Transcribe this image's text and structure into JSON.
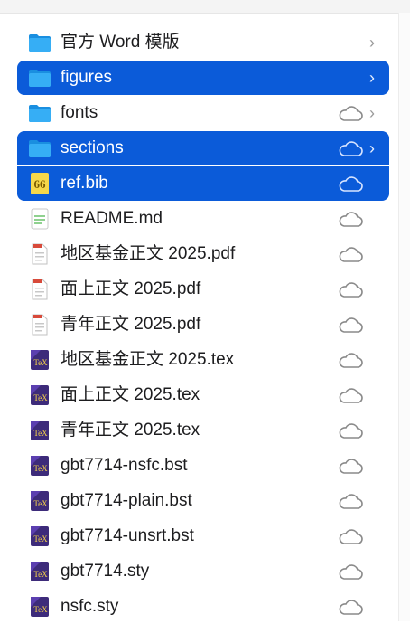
{
  "colors": {
    "selection": "#0b5bd9",
    "folder": "#1ea1f2",
    "text": "#1d1d1f",
    "secondary": "#9a9a9a"
  },
  "files": [
    {
      "label": "官方 Word 模版",
      "icon": "folder-icon",
      "cloud": false,
      "chevron": "›"
    },
    {
      "label": "figures",
      "icon": "folder-icon",
      "cloud": false,
      "chevron": "›"
    },
    {
      "label": "fonts",
      "icon": "folder-icon",
      "cloud": true,
      "chevron": "›"
    },
    {
      "label": "sections",
      "icon": "folder-icon",
      "cloud": true,
      "chevron": "›"
    },
    {
      "label": "ref.bib",
      "icon": "bib-file-icon",
      "cloud": true,
      "chevron": ""
    },
    {
      "label": "README.md",
      "icon": "markdown-file-icon",
      "cloud": true,
      "chevron": ""
    },
    {
      "label": "地区基金正文 2025.pdf",
      "icon": "pdf-file-icon",
      "cloud": true,
      "chevron": ""
    },
    {
      "label": "面上正文 2025.pdf",
      "icon": "pdf-file-icon",
      "cloud": true,
      "chevron": ""
    },
    {
      "label": "青年正文 2025.pdf",
      "icon": "pdf-file-icon",
      "cloud": true,
      "chevron": ""
    },
    {
      "label": "地区基金正文 2025.tex",
      "icon": "tex-file-icon",
      "cloud": true,
      "chevron": ""
    },
    {
      "label": "面上正文 2025.tex",
      "icon": "tex-file-icon",
      "cloud": true,
      "chevron": ""
    },
    {
      "label": "青年正文 2025.tex",
      "icon": "tex-file-icon",
      "cloud": true,
      "chevron": ""
    },
    {
      "label": "gbt7714-nsfc.bst",
      "icon": "tex-file-icon",
      "cloud": true,
      "chevron": ""
    },
    {
      "label": "gbt7714-plain.bst",
      "icon": "tex-file-icon",
      "cloud": true,
      "chevron": ""
    },
    {
      "label": "gbt7714-unsrt.bst",
      "icon": "tex-file-icon",
      "cloud": true,
      "chevron": ""
    },
    {
      "label": "gbt7714.sty",
      "icon": "tex-file-icon",
      "cloud": true,
      "chevron": ""
    },
    {
      "label": "nsfc.sty",
      "icon": "tex-file-icon",
      "cloud": true,
      "chevron": ""
    }
  ],
  "selected_indices": [
    1,
    3,
    4
  ]
}
